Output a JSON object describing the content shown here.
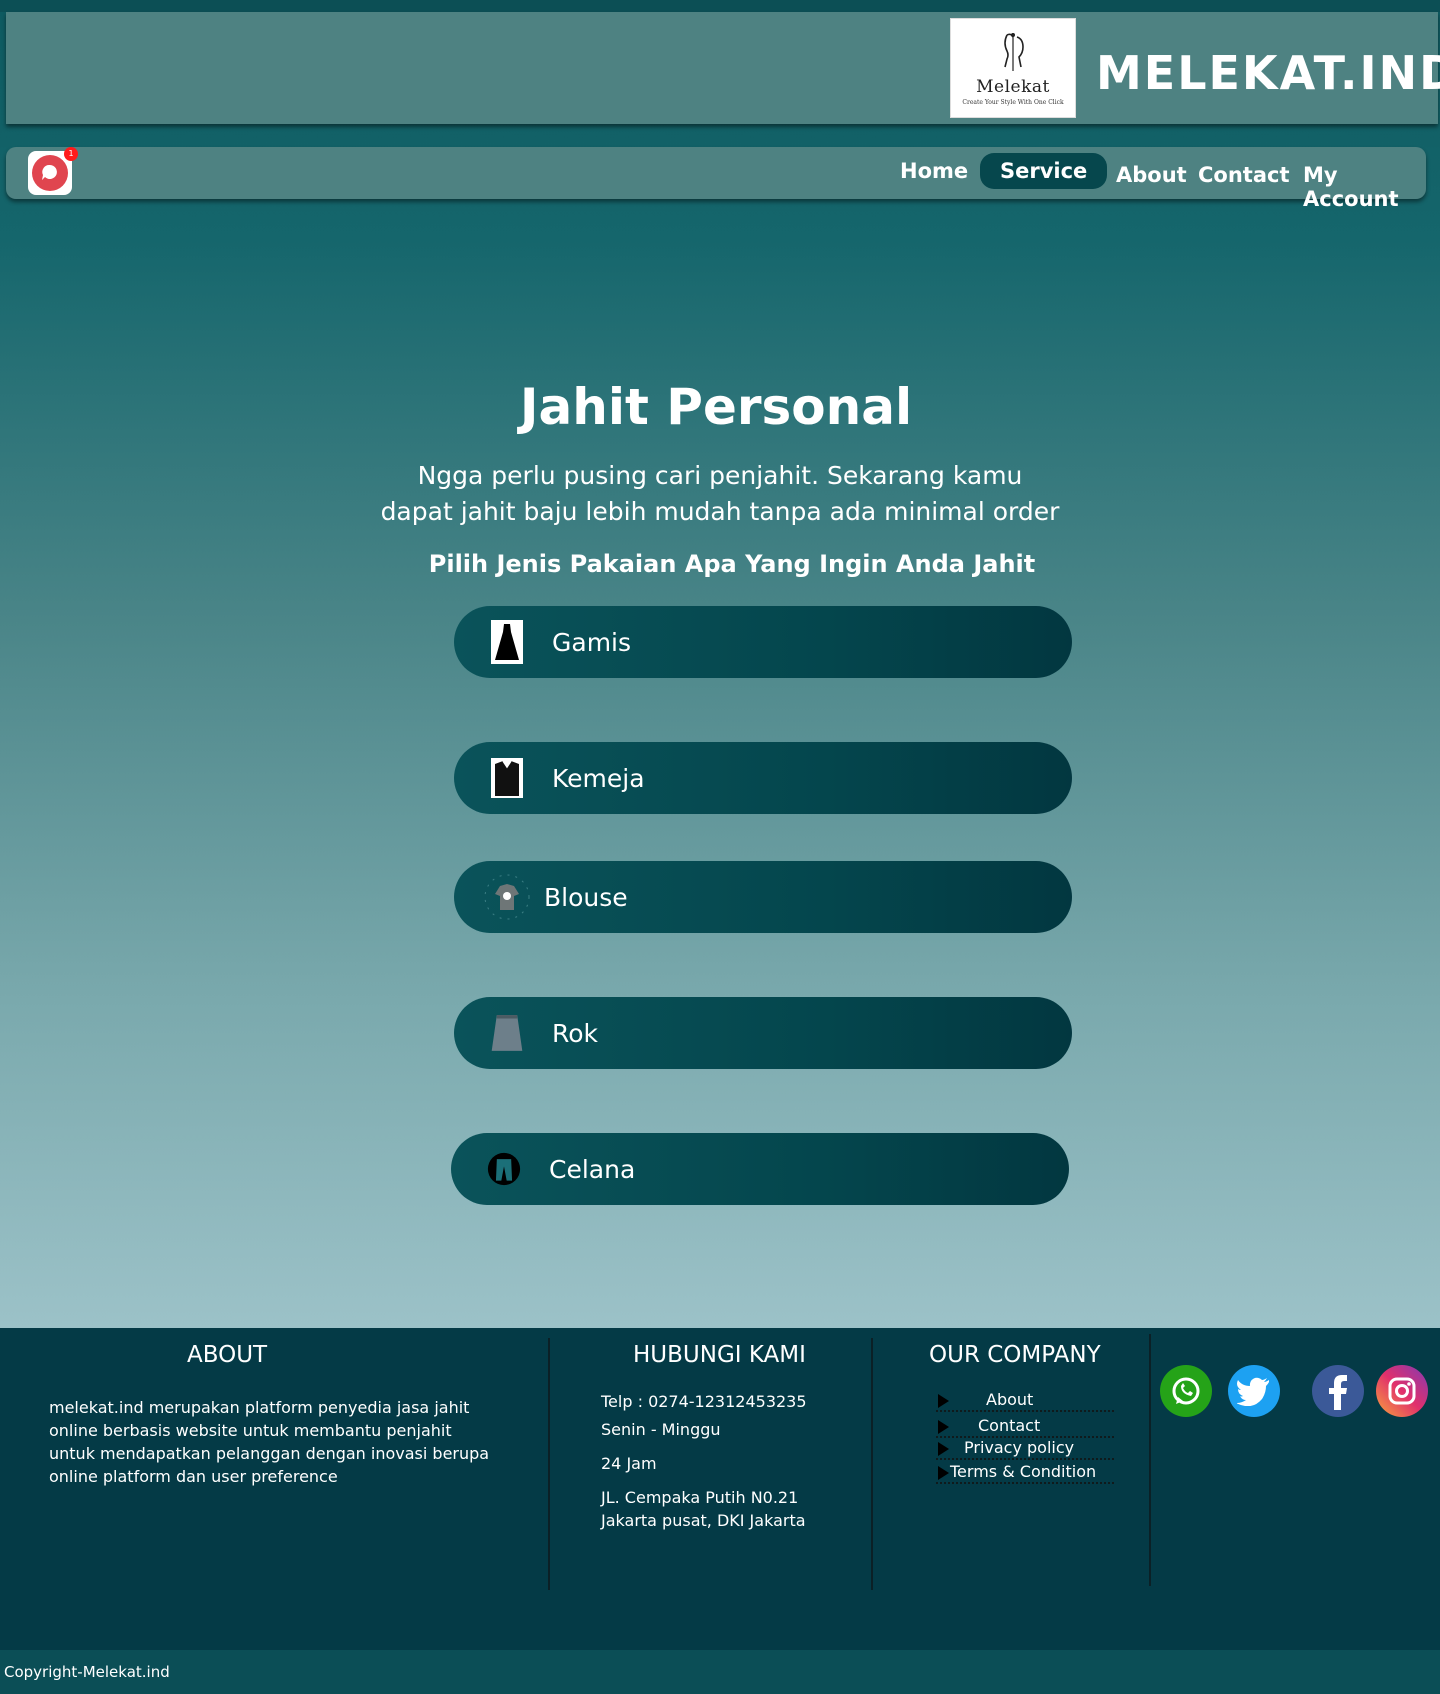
{
  "header": {
    "logo_name": "Melekat",
    "logo_tagline": "Create Your Style With One Click",
    "brand": "MELEKAT.IND"
  },
  "nav": {
    "notification_count": "1",
    "items": [
      {
        "label": "Home"
      },
      {
        "label": "Service"
      },
      {
        "label": "About"
      },
      {
        "label": "Contact"
      },
      {
        "label": "My Account"
      }
    ],
    "active": "Service"
  },
  "hero": {
    "title": "Jahit Personal",
    "subtitle": "Ngga perlu pusing cari penjahit. Sekarang kamu dapat jahit baju lebih mudah tanpa ada minimal order",
    "prompt": "Pilih Jenis Pakaian Apa Yang Ingin Anda Jahit"
  },
  "options": [
    {
      "label": "Gamis",
      "icon": "dress-icon"
    },
    {
      "label": "Kemeja",
      "icon": "shirt-icon"
    },
    {
      "label": "Blouse",
      "icon": "blouse-icon"
    },
    {
      "label": "Rok",
      "icon": "skirt-icon"
    },
    {
      "label": "Celana",
      "icon": "pants-icon"
    }
  ],
  "footer": {
    "about": {
      "heading": "ABOUT",
      "text": "melekat.ind merupakan platform penyedia jasa jahit online berbasis website untuk membantu penjahit untuk mendapatkan pelanggan dengan inovasi berupa online platform dan user preference"
    },
    "contact": {
      "heading": "HUBUNGI KAMI",
      "phone": "Telp  :  0274-12312453235",
      "days": "Senin - Minggu",
      "hours": "24 Jam",
      "address_line1": "JL. Cempaka Putih N0.21",
      "address_line2": "Jakarta pusat, DKI Jakarta"
    },
    "company": {
      "heading": "OUR COMPANY",
      "links": [
        {
          "label": "About"
        },
        {
          "label": "Contact"
        },
        {
          "label": "Privacy policy"
        },
        {
          "label": "Terms & Condition"
        }
      ]
    },
    "social": [
      {
        "name": "whatsapp-icon",
        "color": "#25a318"
      },
      {
        "name": "twitter-icon",
        "color": "#1da1f2"
      },
      {
        "name": "facebook-icon",
        "color": "#3b5998"
      },
      {
        "name": "instagram-icon",
        "color": "#e1306c"
      }
    ],
    "copyright": "Copyright-Melekat.ind"
  },
  "colors": {
    "header_bg": "#4e8282",
    "active_nav_bg": "#06474d",
    "option_bg": "#04464d",
    "footer_bg": "#043a46",
    "notification_red": "#e0454f"
  }
}
